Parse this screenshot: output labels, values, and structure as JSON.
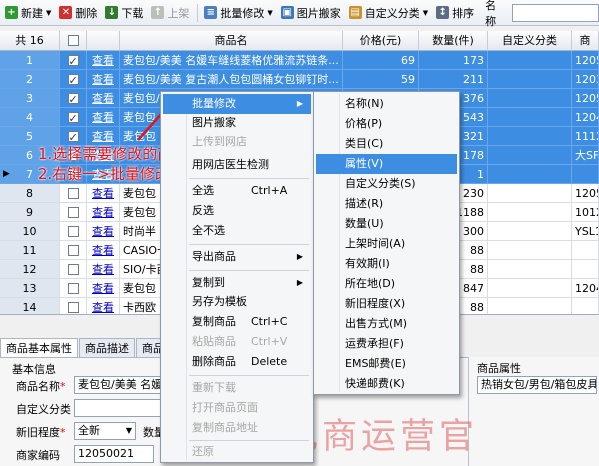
{
  "toolbar": {
    "new": "新建",
    "delete": "删除",
    "download": "下载",
    "upload": "上架",
    "batch_edit": "批量修改",
    "image_move": "图片搬家",
    "custom_category": "自定义分类",
    "sort": "排序",
    "name_label": "名称"
  },
  "grid": {
    "count_header": "共 16",
    "columns": [
      "商品名",
      "价格(元)",
      "数量(件)",
      "自定义分类",
      "商"
    ],
    "view_link": "查看",
    "rows": [
      {
        "n": "1",
        "checked": true,
        "selected": true,
        "name": "麦包包/美美 名媛车缝线菱格优雅流苏链条...",
        "price": "69",
        "qty": "173",
        "code": "1205"
      },
      {
        "n": "2",
        "checked": true,
        "selected": true,
        "name": "麦包包/美美 复古潮人包包圆桶女包铆钉时...",
        "price": "59",
        "qty": "211",
        "code": "1203"
      },
      {
        "n": "3",
        "checked": true,
        "selected": true,
        "name": "麦包包/美美 ...",
        "price": "49",
        "qty": "376",
        "code": "1205"
      },
      {
        "n": "4",
        "checked": true,
        "selected": true,
        "name": "麦包包",
        "price": "",
        "qty": "543",
        "code": "1204"
      },
      {
        "n": "5",
        "checked": true,
        "selected": true,
        "name": "麦包包",
        "price": "",
        "qty": "321",
        "code": "1112"
      },
      {
        "n": "6",
        "checked": true,
        "selected": true,
        "name": "",
        "price": "",
        "qty": "178",
        "code": "大SF"
      },
      {
        "n": "7",
        "checked": true,
        "selected": true,
        "name": "",
        "price": "",
        "qty": "1",
        "code": ""
      },
      {
        "n": "8",
        "checked": false,
        "selected": false,
        "name": "麦包包",
        "price": "",
        "qty": "230",
        "code": "1205"
      },
      {
        "n": "9",
        "checked": false,
        "selected": false,
        "name": "麦包包",
        "price": "",
        "qty": "1188",
        "code": "1012"
      },
      {
        "n": "10",
        "checked": false,
        "selected": false,
        "name": "时尚半",
        "price": "",
        "qty": "300",
        "code": "YSL1"
      },
      {
        "n": "11",
        "checked": false,
        "selected": false,
        "name": "CASIO卡",
        "price": "",
        "qty": "88",
        "code": ""
      },
      {
        "n": "12",
        "checked": false,
        "selected": false,
        "name": "SIO/卡西",
        "price": "",
        "qty": "88",
        "code": ""
      },
      {
        "n": "13",
        "checked": false,
        "selected": false,
        "name": "麦包包",
        "price": "",
        "qty": "847",
        "code": "1204"
      },
      {
        "n": "14",
        "checked": false,
        "selected": false,
        "name": "卡西欧",
        "price": "",
        "qty": "88",
        "code": ""
      },
      {
        "n": "15",
        "checked": false,
        "selected": false,
        "name": "卡西欧",
        "price": "",
        "qty": "88",
        "code": ""
      },
      {
        "n": "16",
        "checked": false,
        "selected": false,
        "name": "卡西欧",
        "price": "",
        "qty": "88",
        "code": ""
      }
    ]
  },
  "context_menu": {
    "batch_edit": "批量修改",
    "image_move": "图片搬家",
    "upload_store": "上传到网店",
    "doctor": "用网店医生检测",
    "select_all": "全选",
    "select_all_sc": "Ctrl+A",
    "invert": "反选",
    "deselect": "全不选",
    "export": "导出商品",
    "copy_to": "复制到",
    "save_template": "另存为模板",
    "copy": "复制商品",
    "copy_sc": "Ctrl+C",
    "paste": "粘贴商品",
    "paste_sc": "Ctrl+V",
    "delete": "删除商品",
    "delete_sc": "Delete",
    "redownload": "重新下载",
    "open_page": "打开商品页面",
    "copy_url": "复制商品地址",
    "restore": "还原"
  },
  "submenu": [
    "名称(N)",
    "价格(P)",
    "类目(C)",
    "属性(V)",
    "自定义分类(S)",
    "描述(R)",
    "数量(U)",
    "上架时间(A)",
    "有效期(I)",
    "所在地(D)",
    "新旧程度(X)",
    "出售方式(M)",
    "运费承担(F)",
    "EMS邮费(E)",
    "快递邮费(K)"
  ],
  "annotation": {
    "step1": "1.选择需要修改的商品",
    "step2": "2.右键一>批量修改"
  },
  "bottom_tabs": [
    "商品基本属性",
    "商品描述",
    "商品"
  ],
  "basic": {
    "section": "基本信息",
    "name_label": "商品名称",
    "name_value": "麦包包/美美 名媛车",
    "custom_label": "自定义分类",
    "condition_label": "新旧程度",
    "condition_value": "全新",
    "qty_label": "数量",
    "code_label": "商家编码",
    "code_value": "12050021"
  },
  "attr_panel": {
    "title": "商品属性",
    "value": "热销女包/男包/箱包皮具"
  },
  "watermark": "电商运营官"
}
